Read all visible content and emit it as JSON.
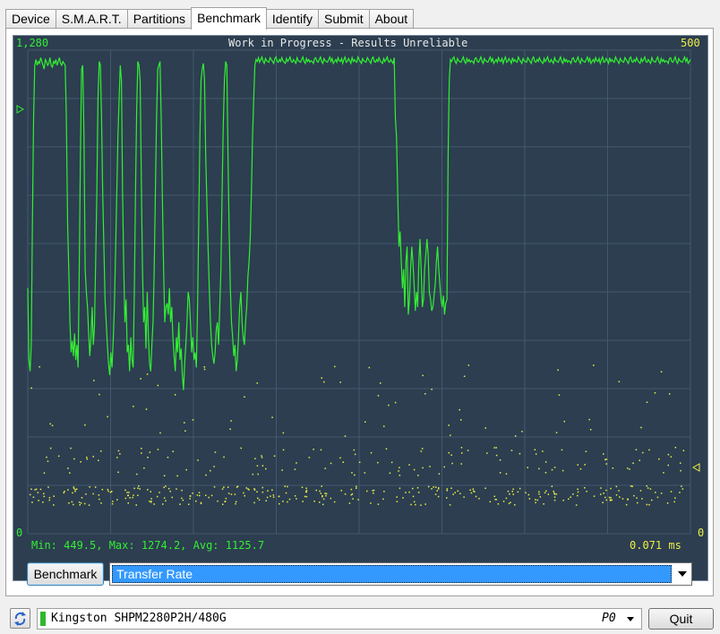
{
  "tabs": [
    {
      "label": "Device",
      "active": false
    },
    {
      "label": "S.M.A.R.T.",
      "active": false
    },
    {
      "label": "Partitions",
      "active": false
    },
    {
      "label": "Benchmark",
      "active": true
    },
    {
      "label": "Identify",
      "active": false
    },
    {
      "label": "Submit",
      "active": false
    },
    {
      "label": "About",
      "active": false
    }
  ],
  "chart": {
    "title": "Work in Progress - Results Unreliable",
    "y_left_max": "1,280",
    "y_left_min": "0",
    "y_right_max": "500",
    "y_right_min": "0",
    "stats": "Min: 449.5, Max: 1274.2, Avg: 1125.7",
    "access_time": "0.071 ms",
    "colors": {
      "transfer": "#33ee33",
      "access": "#eeee44",
      "background": "#2c3e50",
      "grid": "#44586e"
    }
  },
  "chart_data": {
    "type": "line",
    "series": [
      {
        "axis": "left",
        "ylim": [
          0,
          1280
        ],
        "values": [
          650,
          460,
          430,
          500,
          820,
          1100,
          1240,
          1255,
          1240,
          1250,
          1245,
          1260,
          1250,
          1240,
          1230,
          1255,
          1250,
          1240,
          1245,
          1260,
          1240,
          1235,
          1250,
          1245,
          1255,
          1240,
          1250,
          1260,
          1245,
          1240,
          1250,
          1245,
          1240,
          1100,
          820,
          700,
          560,
          480,
          510,
          470,
          530,
          460,
          500,
          440,
          700,
          1000,
          1230,
          1240,
          1050,
          700,
          640,
          600,
          530,
          470,
          520,
          600,
          500,
          550,
          720,
          900,
          1150,
          1250,
          1240,
          1100,
          900,
          760,
          620,
          560,
          500,
          450,
          420,
          480,
          440,
          510,
          600,
          750,
          900,
          1050,
          1150,
          1240,
          1200,
          900,
          700,
          560,
          620,
          480,
          500,
          430,
          520,
          460,
          440,
          640,
          900,
          1120,
          1250,
          1240,
          1200,
          940,
          700,
          560,
          600,
          490,
          640,
          520,
          450,
          430,
          500,
          560,
          700,
          900,
          1100,
          1230,
          1240,
          1250,
          1100,
          880,
          700,
          560,
          600,
          610,
          580,
          650,
          560,
          600,
          520,
          470,
          430,
          520,
          480,
          560,
          460,
          490,
          420,
          380,
          450,
          500,
          560,
          640,
          620,
          560,
          480,
          520,
          460,
          480,
          440,
          600,
          820,
          1050,
          1200,
          1230,
          1245,
          1200,
          1000,
          880,
          760,
          650,
          560,
          500,
          470,
          450,
          480,
          540,
          560,
          500,
          600,
          700,
          900,
          1080,
          1200,
          1250,
          1240,
          1000,
          800,
          650,
          560,
          520,
          470,
          500,
          430,
          460,
          520,
          600,
          640,
          560,
          520,
          500,
          560,
          600,
          680,
          720,
          780,
          900,
          1050,
          1150,
          1240,
          1255,
          1250,
          1260,
          1248,
          1255,
          1262,
          1250,
          1245,
          1258,
          1252,
          1250,
          1248,
          1260,
          1255,
          1250,
          1245,
          1258,
          1262,
          1250,
          1248,
          1255,
          1250,
          1260,
          1252,
          1248,
          1245,
          1258,
          1250,
          1255,
          1262,
          1250,
          1248,
          1255,
          1250,
          1245,
          1260,
          1252,
          1250,
          1248,
          1255,
          1262,
          1250,
          1245,
          1258,
          1250,
          1255,
          1248,
          1252,
          1250,
          1245,
          1258,
          1260,
          1250,
          1248,
          1255,
          1262,
          1250,
          1245,
          1258,
          1252,
          1250,
          1248,
          1255,
          1262,
          1250,
          1258,
          1245,
          1250,
          1255,
          1248,
          1260,
          1252,
          1250,
          1258,
          1245,
          1255,
          1262,
          1248,
          1250,
          1258,
          1252,
          1245,
          1260,
          1250,
          1255,
          1250,
          1248,
          1262,
          1255,
          1250,
          1245,
          1258,
          1252,
          1250,
          1248,
          1260,
          1255,
          1250,
          1245,
          1258,
          1262,
          1250,
          1248,
          1255,
          1250,
          1260,
          1252,
          1248,
          1245,
          1258,
          1250,
          1255,
          1262,
          1250,
          1248,
          1255,
          1250,
          1245,
          1260,
          1100,
          1050,
          900,
          760,
          800,
          720,
          650,
          700,
          600,
          720,
          760,
          580,
          620,
          700,
          760,
          720,
          660,
          590,
          640,
          600,
          720,
          780,
          700,
          600,
          620,
          700,
          740,
          780,
          740,
          640,
          620,
          590,
          600,
          630,
          660,
          720,
          760,
          700,
          660,
          620,
          600,
          630,
          580,
          610,
          620,
          1000,
          1200,
          1255,
          1250,
          1258,
          1262,
          1250,
          1245,
          1258,
          1252,
          1250,
          1248,
          1255,
          1262,
          1250,
          1245,
          1258,
          1250,
          1255,
          1248,
          1252,
          1250,
          1245,
          1258,
          1260,
          1250,
          1248,
          1255,
          1262,
          1250,
          1245,
          1258,
          1252,
          1250,
          1248,
          1255,
          1262,
          1250,
          1258,
          1245,
          1250,
          1255,
          1248,
          1260,
          1252,
          1250,
          1258,
          1245,
          1255,
          1262,
          1248,
          1250,
          1258,
          1252,
          1245,
          1260,
          1250,
          1255,
          1250,
          1248,
          1262,
          1255,
          1250,
          1245,
          1258,
          1252,
          1250,
          1248,
          1260,
          1255,
          1250,
          1245,
          1258,
          1262,
          1250,
          1248,
          1255,
          1250,
          1260,
          1252,
          1248,
          1245,
          1258,
          1250,
          1255,
          1262,
          1250,
          1248,
          1255,
          1250,
          1245,
          1260,
          1252,
          1250,
          1248,
          1255,
          1262,
          1250,
          1245,
          1258,
          1250,
          1255,
          1248,
          1252,
          1250,
          1245,
          1258,
          1260,
          1250,
          1248,
          1255,
          1262,
          1250,
          1245,
          1258,
          1252,
          1250,
          1248,
          1255,
          1262,
          1250,
          1258,
          1245,
          1250,
          1255,
          1248,
          1260,
          1252,
          1250,
          1258,
          1245,
          1255,
          1262,
          1248,
          1250,
          1258,
          1252,
          1245,
          1260,
          1250,
          1255,
          1250,
          1248,
          1262,
          1255,
          1250,
          1245,
          1258,
          1252,
          1250,
          1248,
          1260,
          1255,
          1250,
          1245,
          1258,
          1262,
          1250,
          1248,
          1255,
          1250,
          1260,
          1252,
          1248,
          1245,
          1258,
          1250,
          1255,
          1262,
          1250,
          1248,
          1255,
          1250,
          1245,
          1260,
          1252,
          1250,
          1248,
          1255,
          1262,
          1250,
          1245,
          1258,
          1250,
          1255,
          1248,
          1252,
          1250,
          1245,
          1258,
          1260,
          1250,
          1248,
          1255,
          1262,
          1250,
          1245,
          1258,
          1252,
          1250,
          1248,
          1255,
          1262,
          1250,
          1258,
          1245,
          1250,
          1255
        ]
      }
    ],
    "access_time_scatter": {
      "axis": "right",
      "ylim": [
        0,
        500
      ],
      "note_bands_ms": [
        [
          0.02,
          0.04
        ],
        [
          0.05,
          0.13
        ],
        [
          0.14,
          0.25
        ]
      ]
    }
  },
  "controls": {
    "benchmark_label": "Benchmark",
    "mode_selected": "Transfer Rate"
  },
  "status": {
    "device": "Kingston SHPM2280P2H/480G",
    "port": "P0",
    "quit_label": "Quit"
  }
}
